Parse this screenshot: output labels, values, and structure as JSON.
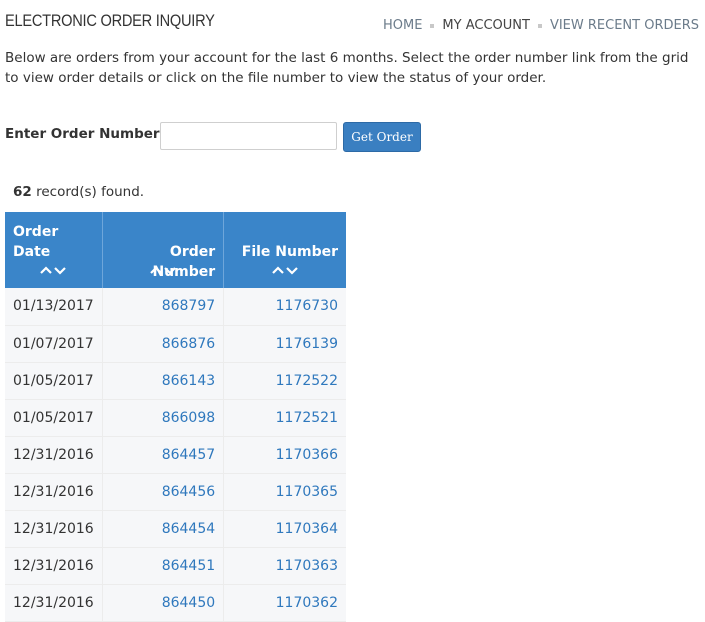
{
  "header": {
    "title": "ELECTRONIC ORDER INQUIRY",
    "nav": [
      {
        "label": "HOME"
      },
      {
        "label": "MY ACCOUNT"
      },
      {
        "label": "VIEW RECENT ORDERS"
      }
    ]
  },
  "intro_text": "Below are orders from your account for the last 6 months. Select the order number link from the grid to view order details or click on the file number to view the status of your order.",
  "search": {
    "label": "Enter Order Number:",
    "value": "",
    "button_label": "Get Order"
  },
  "records": {
    "count": "62",
    "suffix": " record(s) found."
  },
  "grid": {
    "columns": [
      {
        "label": "Order Date",
        "icon": "sort-icon"
      },
      {
        "label": "Order Number",
        "icon": "sort-icon"
      },
      {
        "label": "File Number",
        "icon": "sort-icon"
      }
    ],
    "rows": [
      {
        "date": "01/13/2017",
        "order": "868797",
        "file": "1176730"
      },
      {
        "date": "01/07/2017",
        "order": "866876",
        "file": "1176139"
      },
      {
        "date": "01/05/2017",
        "order": "866143",
        "file": "1172522"
      },
      {
        "date": "01/05/2017",
        "order": "866098",
        "file": "1172521"
      },
      {
        "date": "12/31/2016",
        "order": "864457",
        "file": "1170366"
      },
      {
        "date": "12/31/2016",
        "order": "864456",
        "file": "1170365"
      },
      {
        "date": "12/31/2016",
        "order": "864454",
        "file": "1170364"
      },
      {
        "date": "12/31/2016",
        "order": "864451",
        "file": "1170363"
      },
      {
        "date": "12/31/2016",
        "order": "864450",
        "file": "1170362"
      }
    ]
  },
  "colors": {
    "header_blue": "#3a85c9",
    "link_blue": "#2f78bd",
    "button_blue": "#3a7fc1"
  }
}
